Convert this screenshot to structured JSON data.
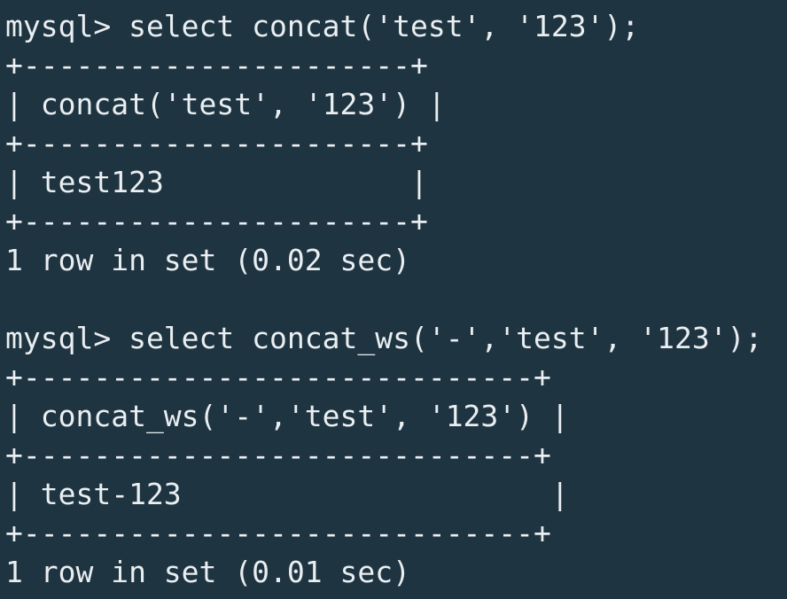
{
  "terminal": {
    "lines": [
      "mysql> select concat('test', '123');",
      "+----------------------+",
      "| concat('test', '123') |",
      "+----------------------+",
      "| test123              |",
      "+----------------------+",
      "1 row in set (0.02 sec)",
      "",
      "mysql> select concat_ws('-','test', '123');",
      "+-----------------------------+",
      "| concat_ws('-','test', '123') |",
      "+-----------------------------+",
      "| test-123                     |",
      "+-----------------------------+",
      "1 row in set (0.01 sec)"
    ]
  }
}
